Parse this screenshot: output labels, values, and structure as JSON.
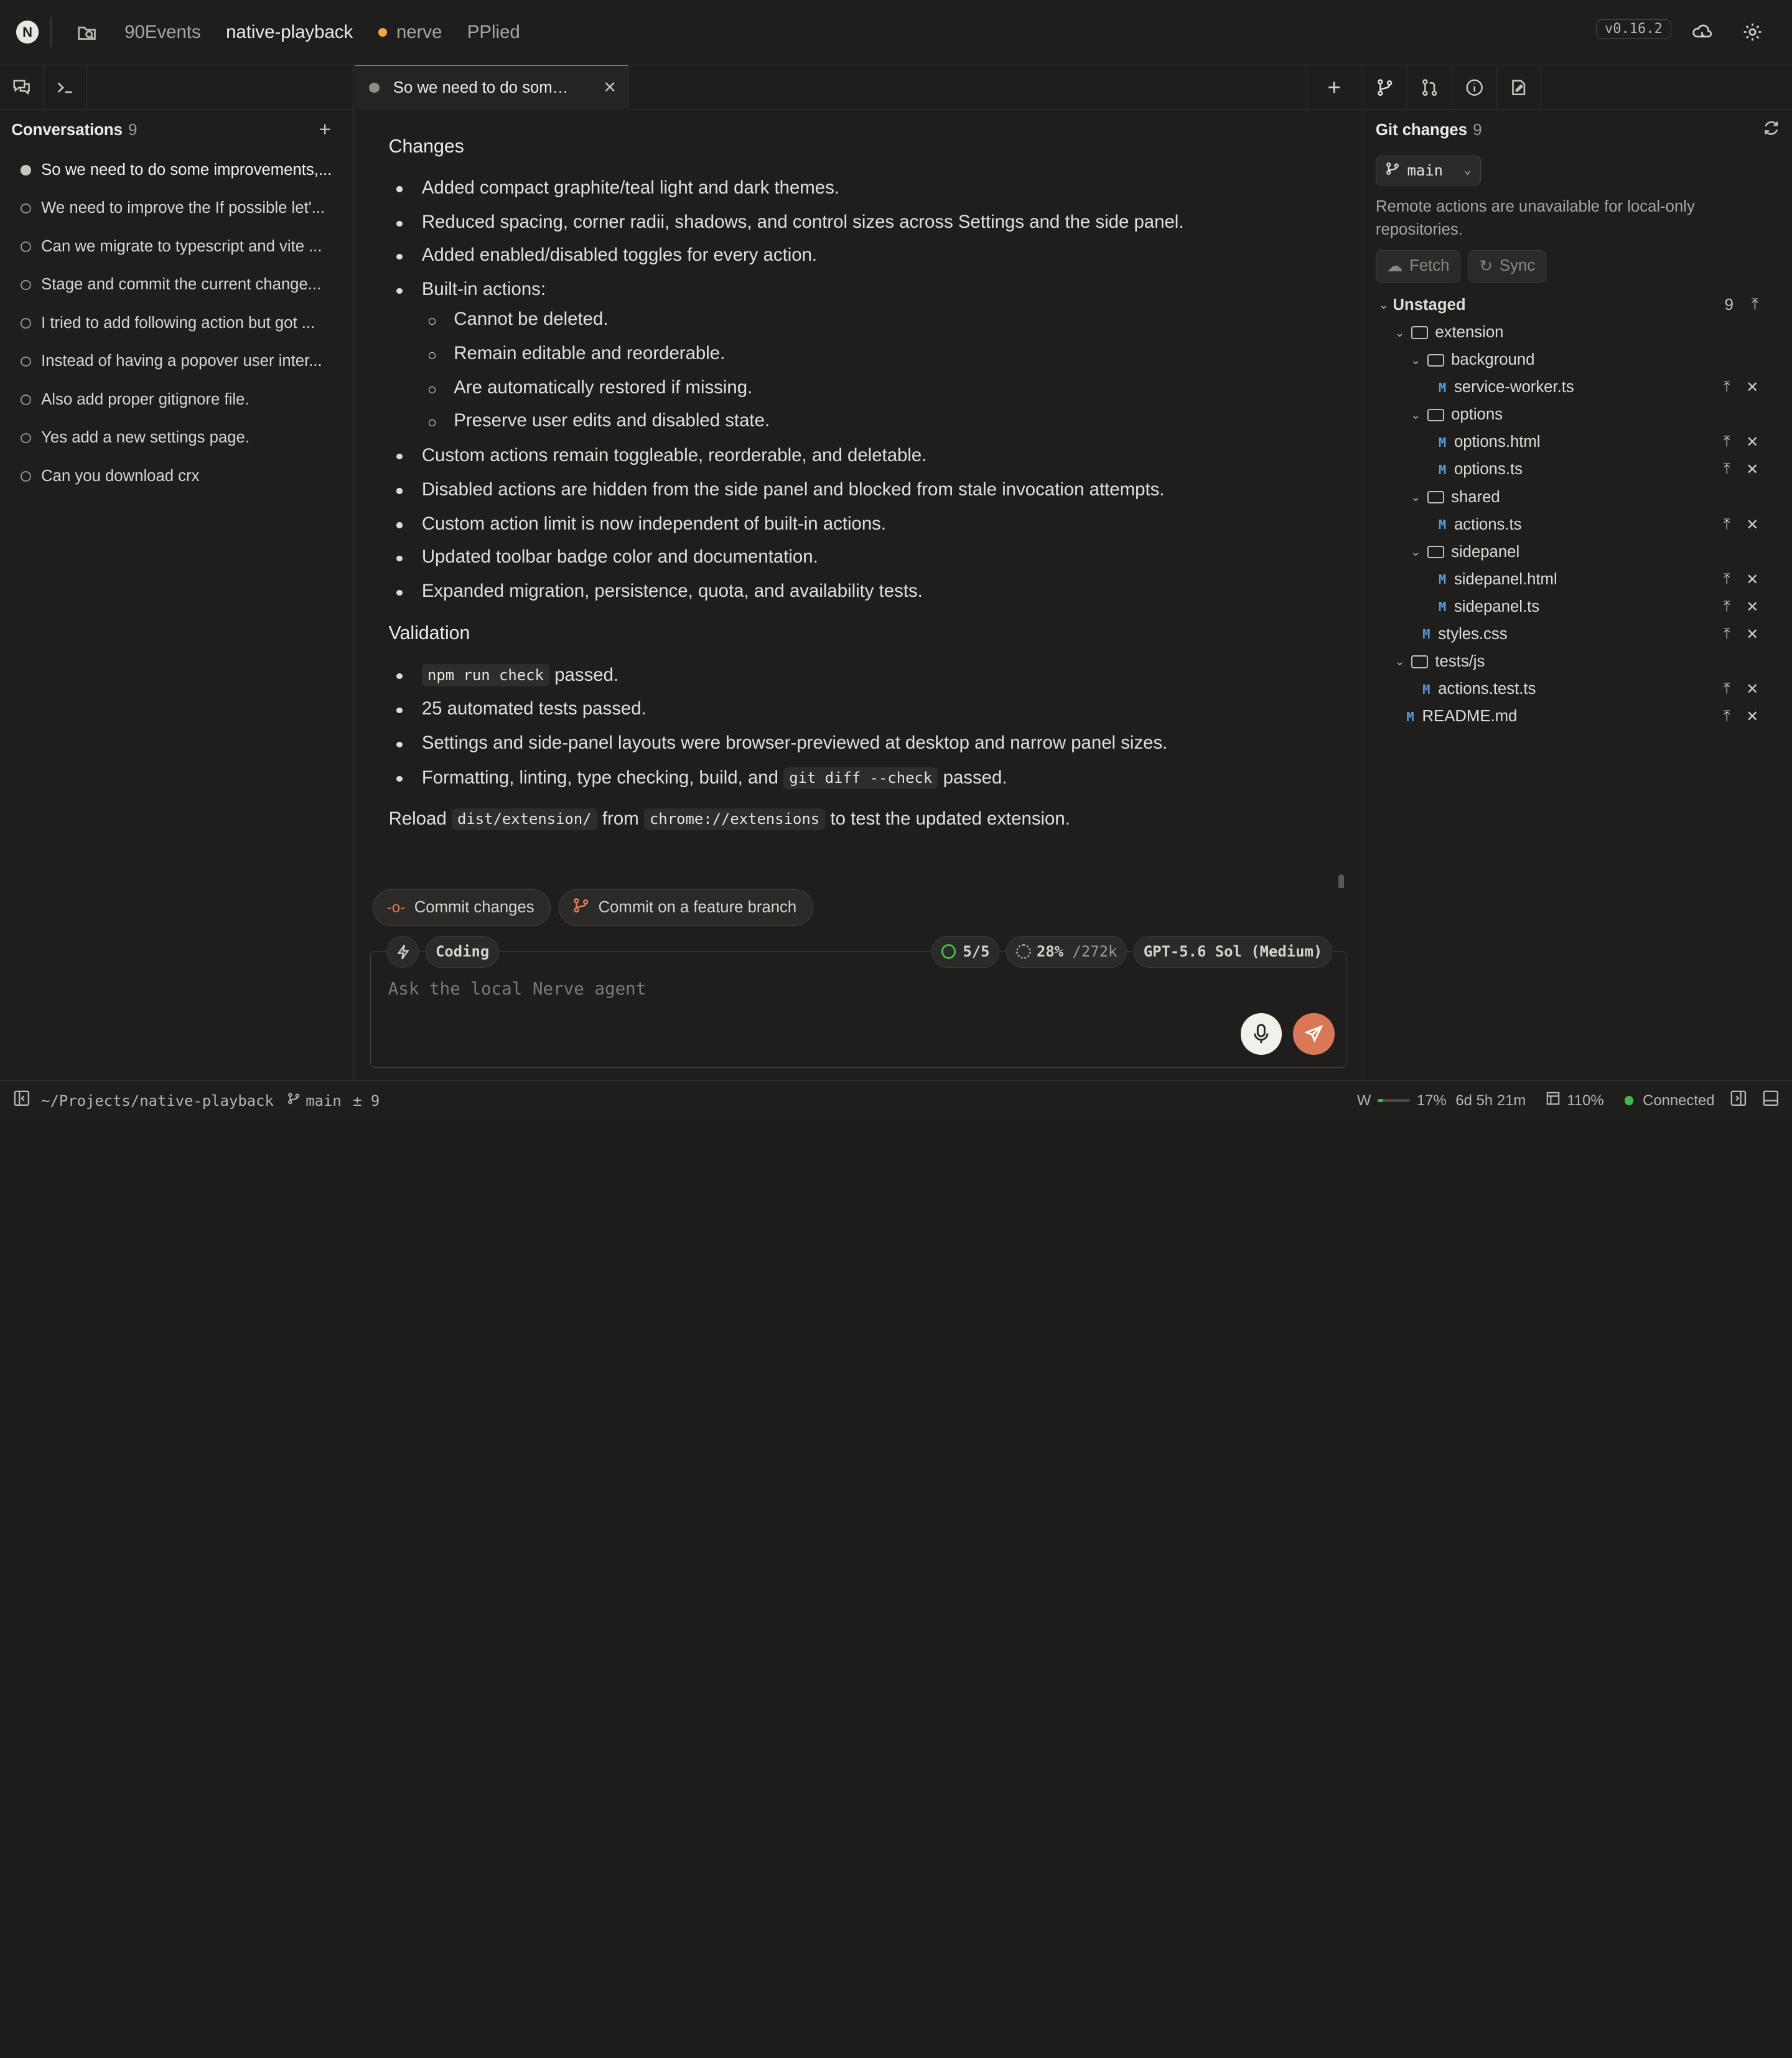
{
  "topbar": {
    "logo": "N",
    "items": [
      "90Events",
      "native-playback",
      "nerve",
      "PPlied"
    ],
    "version": "v0.16.2"
  },
  "conversations": {
    "title": "Conversations",
    "count": "9",
    "items": [
      "So we need to do some improvements,...",
      "We need to improve the If possible let'...",
      "Can we migrate to typescript and vite ...",
      "Stage and commit the current change...",
      "I tried to add following action but got ...",
      "Instead of having a popover user inter...",
      "Also add proper gitignore file.",
      "Yes add a new settings page.",
      "Can you download crx"
    ]
  },
  "tab": {
    "title": "So we need to do some i..."
  },
  "message": {
    "changes_heading": "Changes",
    "changes": [
      "Added compact graphite/teal light and dark themes.",
      "Reduced spacing, corner radii, shadows, and control sizes across Settings and the side panel.",
      "Added enabled/disabled toggles for every action.",
      "Built-in actions:"
    ],
    "builtin": [
      "Cannot be deleted.",
      "Remain editable and reorderable.",
      "Are automatically restored if missing.",
      "Preserve user edits and disabled state."
    ],
    "changes2": [
      "Custom actions remain toggleable, reorderable, and deletable.",
      "Disabled actions are hidden from the side panel and blocked from stale invocation attempts.",
      "Custom action limit is now independent of built-in actions.",
      "Updated toolbar badge color and documentation.",
      "Expanded migration, persistence, quota, and availability tests."
    ],
    "validation_heading": "Validation",
    "v1_code": "npm run check",
    "v1_text": " passed.",
    "v2": "25 automated tests passed.",
    "v3": "Settings and side-panel layouts were browser-previewed at desktop and narrow panel sizes.",
    "v4_text": "Formatting, linting, type checking, build, and ",
    "v4_code": "git diff --check",
    "v4_tail": " passed.",
    "reload_a": "Reload ",
    "reload_code1": "dist/extension/",
    "reload_b": " from ",
    "reload_code2": "chrome://extensions",
    "reload_c": " to test the updated extension."
  },
  "actions": {
    "commit": "Commit changes",
    "commit_branch": "Commit on a feature branch"
  },
  "composer": {
    "mode": "Coding",
    "tasks": "5/5",
    "context_pct": "28%",
    "context_total": "/272k",
    "model": "GPT-5.6 Sol (Medium)",
    "placeholder": "Ask the local Nerve agent"
  },
  "git": {
    "title": "Git changes",
    "count": "9",
    "branch": "main",
    "note": "Remote actions are unavailable for local-only repositories.",
    "fetch": "Fetch",
    "sync": "Sync",
    "unstaged": "Unstaged",
    "unstaged_count": "9",
    "tree": [
      {
        "type": "folder",
        "name": "extension",
        "depth": 1
      },
      {
        "type": "folder",
        "name": "background",
        "depth": 2
      },
      {
        "type": "file",
        "name": "service-worker.ts",
        "depth": 3
      },
      {
        "type": "folder",
        "name": "options",
        "depth": 2
      },
      {
        "type": "file",
        "name": "options.html",
        "depth": 3
      },
      {
        "type": "file",
        "name": "options.ts",
        "depth": 3
      },
      {
        "type": "folder",
        "name": "shared",
        "depth": 2
      },
      {
        "type": "file",
        "name": "actions.ts",
        "depth": 3
      },
      {
        "type": "folder",
        "name": "sidepanel",
        "depth": 2
      },
      {
        "type": "file",
        "name": "sidepanel.html",
        "depth": 3
      },
      {
        "type": "file",
        "name": "sidepanel.ts",
        "depth": 3
      },
      {
        "type": "file",
        "name": "styles.css",
        "depth": 2
      },
      {
        "type": "folder",
        "name": "tests/js",
        "depth": 1
      },
      {
        "type": "file",
        "name": "actions.test.ts",
        "depth": 2
      },
      {
        "type": "file",
        "name": "README.md",
        "depth": 1
      }
    ]
  },
  "status": {
    "path": "~/Projects/native-playback",
    "branch": "main",
    "changes": "± 9",
    "w": "W",
    "usage": "17%",
    "usage_fraction": 0.17,
    "time": "6d 5h 21m",
    "zoom": "110%",
    "connection": "Connected"
  },
  "colors": {
    "accent": "#d97757",
    "modified": "#5b9bd5",
    "connected": "#3fb950",
    "dirty": "#f2a93b"
  }
}
